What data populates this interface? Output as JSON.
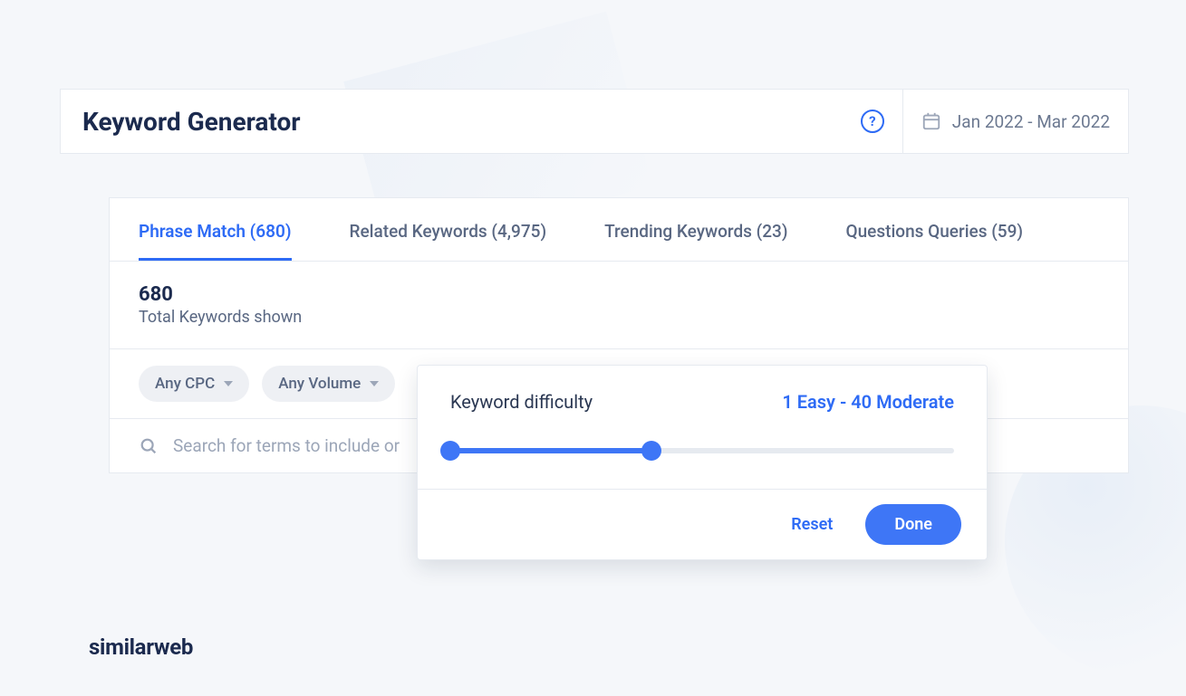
{
  "header": {
    "title": "Keyword Generator",
    "date_range": "Jan 2022 - Mar 2022"
  },
  "tabs": [
    {
      "label": "Phrase Match (680)",
      "active": true
    },
    {
      "label": "Related Keywords (4,975)",
      "active": false
    },
    {
      "label": "Trending Keywords (23)",
      "active": false
    },
    {
      "label": "Questions Queries (59)",
      "active": false
    }
  ],
  "stats": {
    "count": "680",
    "label": "Total Keywords shown"
  },
  "filters": {
    "chips": [
      {
        "label": "Any CPC"
      },
      {
        "label": "Any Volume"
      }
    ]
  },
  "search": {
    "placeholder": "Search for terms to include or"
  },
  "popover": {
    "label": "Keyword difficulty",
    "value": "1 Easy - 40 Moderate",
    "slider": {
      "min": 1,
      "max": 100,
      "low": 1,
      "high": 40
    },
    "reset_label": "Reset",
    "done_label": "Done"
  },
  "brand": {
    "name": "similarweb"
  },
  "colors": {
    "primary": "#2e6bf5",
    "text": "#1b2a4e",
    "muted": "#596782"
  }
}
